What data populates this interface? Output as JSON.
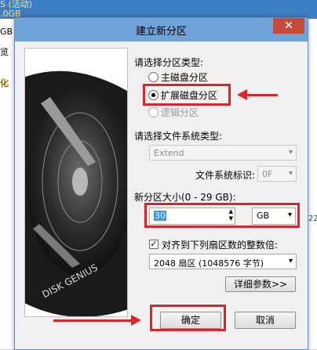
{
  "background": {
    "top_text": "S (活动)\n.0GB",
    "left_labels": [
      "GB",
      "览",
      "化"
    ],
    "right_label": "22"
  },
  "dialog": {
    "title": "建立新分区",
    "close_icon": "close-icon",
    "partition_type_label": "请选择分区类型:",
    "radio_primary": "主磁盘分区",
    "radio_extended": "扩展磁盘分区",
    "radio_logical": "逻辑分区",
    "fs_type_label": "请选择文件系统类型:",
    "fs_type_value": "Extend",
    "fs_id_label": "文件系统标识:",
    "fs_id_value": "0F",
    "size_label": "新分区大小(0 - 29 GB):",
    "size_value": "30",
    "size_unit": "GB",
    "align_label": "对齐到下列扇区数的整数倍:",
    "align_value": "2048 扇区 (1048576 字节)",
    "detail_button": "详细参数>>",
    "ok_button": "确定",
    "cancel_button": "取消",
    "art_brand": "DISK GENIUS"
  },
  "colors": {
    "highlight_red": "#d9262c",
    "titlebar_blue": "#6fa3d9",
    "close_red": "#c74b3a"
  }
}
